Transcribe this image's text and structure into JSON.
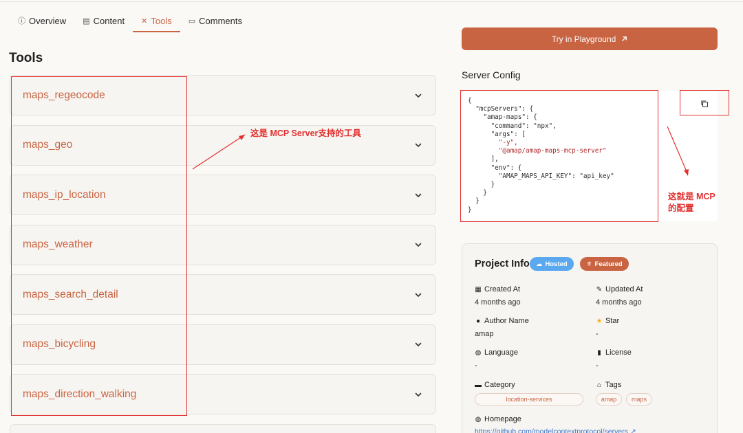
{
  "tabs": [
    {
      "label": "Overview",
      "icon": "info-circle-icon",
      "glyph": "ⓘ"
    },
    {
      "label": "Content",
      "icon": "document-icon",
      "glyph": "▤"
    },
    {
      "label": "Tools",
      "icon": "tools-icon",
      "glyph": "✕"
    },
    {
      "label": "Comments",
      "icon": "comment-icon",
      "glyph": "▭"
    }
  ],
  "tools_heading": "Tools",
  "tools": [
    "maps_regeocode",
    "maps_geo",
    "maps_ip_location",
    "maps_weather",
    "maps_search_detail",
    "maps_bicycling",
    "maps_direction_walking"
  ],
  "annotations": {
    "tools_note": "这是 MCP Server支持的工具",
    "config_note_line1": "这就是 MCP",
    "config_note_line2": "的配置"
  },
  "try_button": {
    "label": "Try in Playground",
    "icon": "arrow-up-right-icon"
  },
  "server_config": {
    "title": "Server Config",
    "code_lines": [
      "{",
      "  \"mcpServers\": {",
      "    \"amap-maps\": {",
      "      \"command\": \"npx\",",
      "      \"args\": [",
      "        \"-y\",",
      "        \"@amap/amap-maps-mcp-server\"",
      "      ],",
      "      \"env\": {",
      "        \"AMAP_MAPS_API_KEY\": \"api_key\"",
      "      }",
      "    }",
      "  }",
      "}"
    ]
  },
  "project_info": {
    "title": "Project Info",
    "hosted": "Hosted",
    "featured": "Featured",
    "created_label": "Created At",
    "created_value": "4 months ago",
    "updated_label": "Updated At",
    "updated_value": "4 months ago",
    "author_label": "Author Name",
    "author_value": "amap",
    "star_label": "Star",
    "star_value": "-",
    "language_label": "Language",
    "language_value": "-",
    "license_label": "License",
    "license_value": "-",
    "category_label": "Category",
    "category_tag": "location-services",
    "tags_label": "Tags",
    "tags": [
      "amap",
      "maps"
    ],
    "homepage_label": "Homepage",
    "homepage_url": "https://github.com/modelcontextprotocol/servers ↗"
  },
  "colors": {
    "accent": "#c96442",
    "annotation": "#e23030",
    "hosted": "#5aa8f0",
    "link": "#3b74c9"
  }
}
